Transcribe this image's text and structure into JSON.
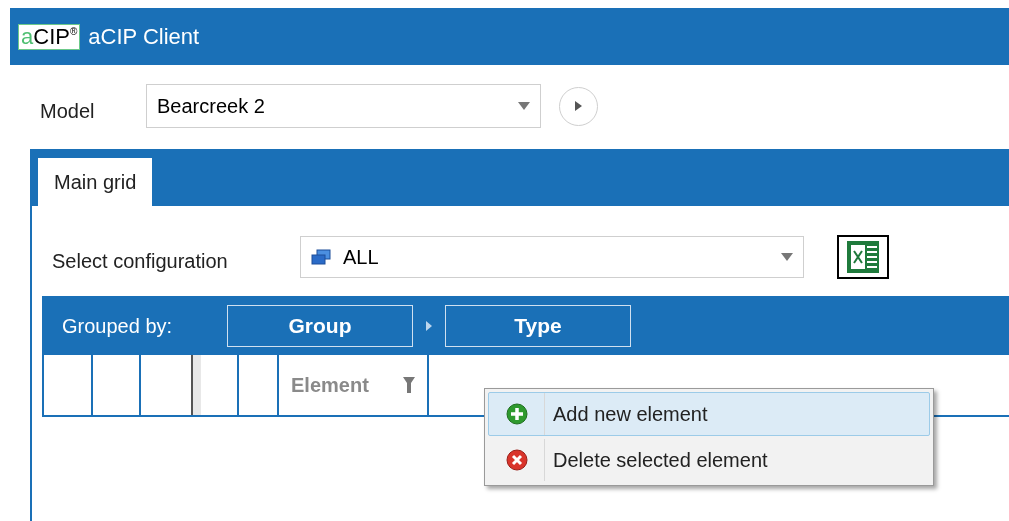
{
  "window": {
    "logo": {
      "prefix": "a",
      "name": "CIP",
      "mark": "®"
    },
    "title": "aCIP Client"
  },
  "model": {
    "label": "Model",
    "value": "Bearcreek 2"
  },
  "tabs": [
    {
      "label": "Main grid",
      "selected": true
    }
  ],
  "configuration": {
    "label": "Select configuration",
    "value": "ALL"
  },
  "grouping": {
    "label": "Grouped by:",
    "groups": [
      "Group",
      "Type"
    ]
  },
  "table": {
    "columns": [
      {
        "label": "Element",
        "filter": true
      }
    ]
  },
  "context_menu": {
    "items": [
      {
        "kind": "add",
        "label": "Add new element",
        "selected": true
      },
      {
        "kind": "delete",
        "label": "Delete selected element",
        "selected": false
      }
    ]
  }
}
